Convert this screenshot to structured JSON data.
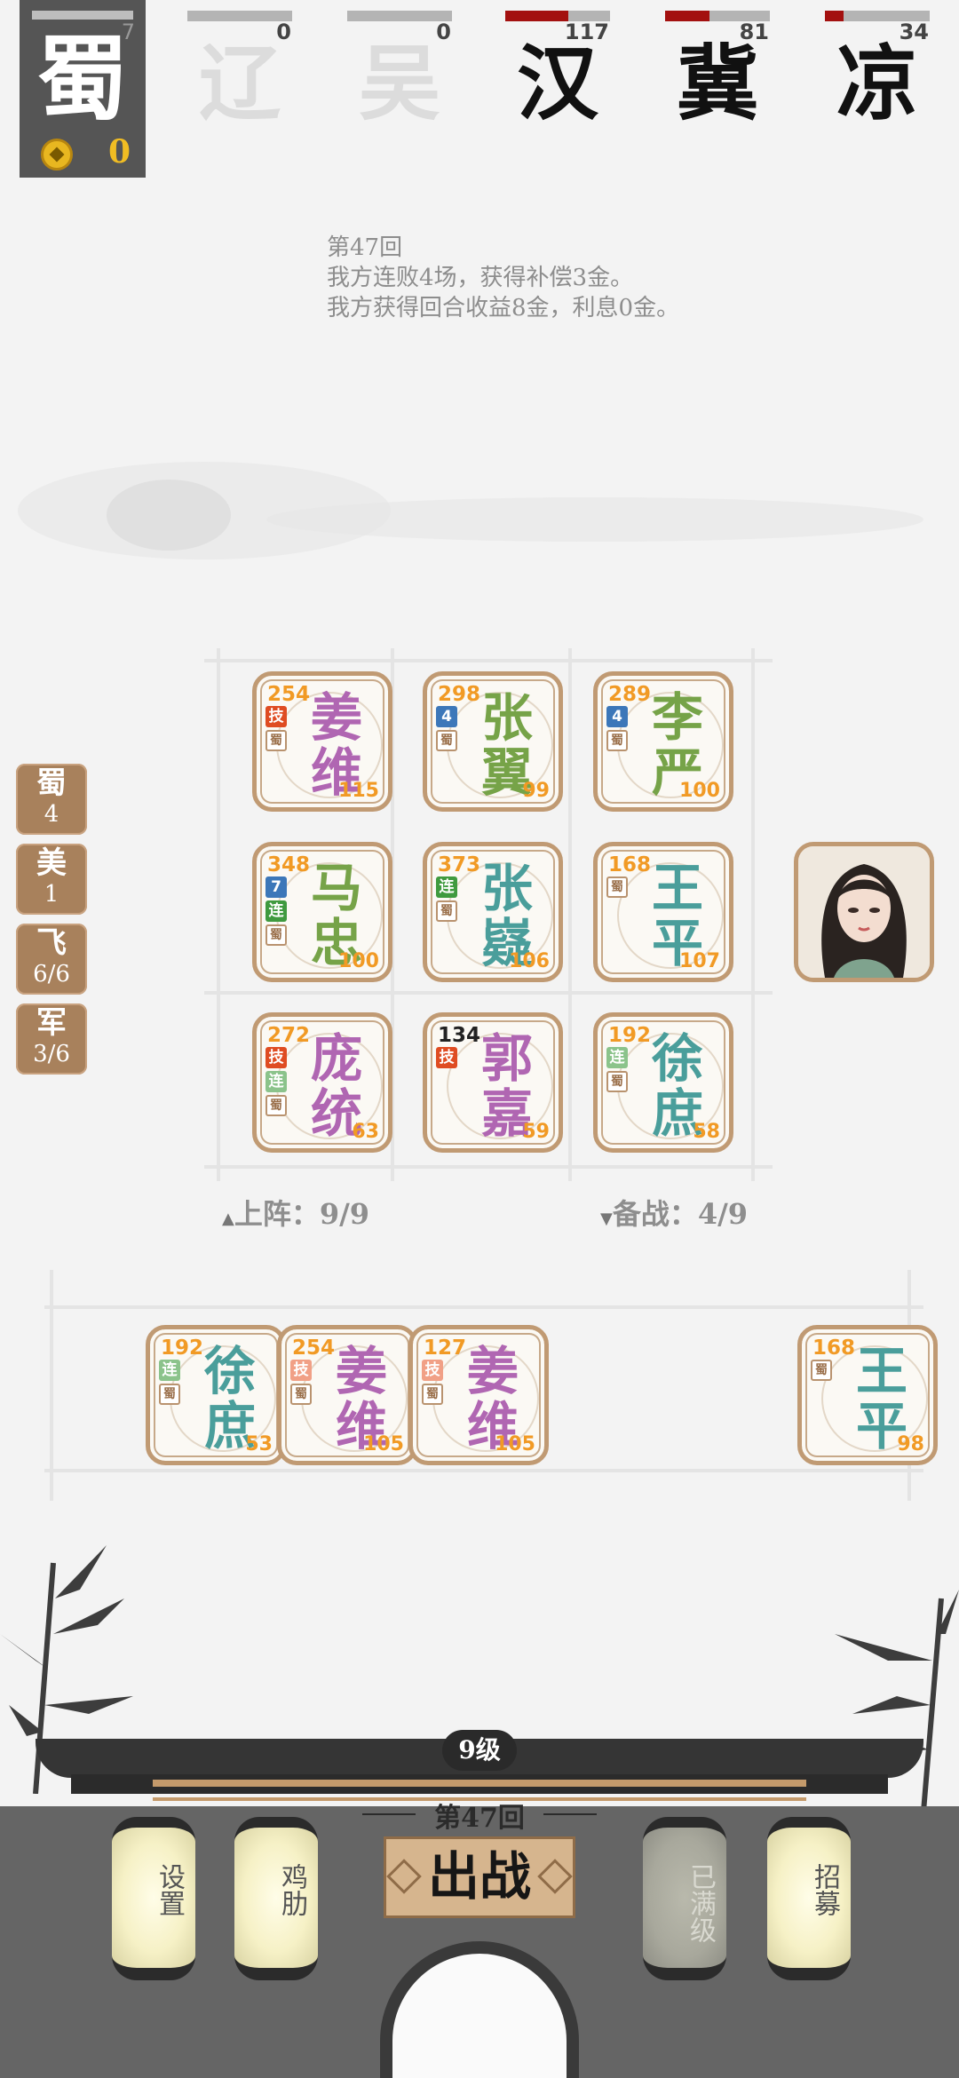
{
  "player": {
    "faction": "蜀",
    "hp": "7",
    "gold": "0"
  },
  "factions": [
    {
      "name": "辽",
      "hp": "0",
      "hp_fraction": 0,
      "active": false
    },
    {
      "name": "吴",
      "hp": "0",
      "hp_fraction": 0,
      "active": false
    },
    {
      "name": "汉",
      "hp": "117",
      "hp_fraction": 0.6,
      "active": true
    },
    {
      "name": "冀",
      "hp": "81",
      "hp_fraction": 0.42,
      "active": true
    },
    {
      "name": "凉",
      "hp": "34",
      "hp_fraction": 0.18,
      "active": true
    }
  ],
  "log": {
    "line1": "第47回",
    "line2": "我方连败4场，获得补偿3金。",
    "line3": "我方获得回合收益8金，利息0金。"
  },
  "board": [
    {
      "name_top": "姜",
      "name_bottom": "维",
      "hp": "254",
      "atk": "115",
      "color": "purple",
      "tags": [
        "技",
        "蜀"
      ]
    },
    {
      "name_top": "张",
      "name_bottom": "翼",
      "hp": "298",
      "atk": "99",
      "color": "green",
      "tags": [
        "4",
        "蜀"
      ]
    },
    {
      "name_top": "李",
      "name_bottom": "严",
      "hp": "289",
      "atk": "100",
      "color": "green",
      "tags": [
        "4",
        "蜀"
      ]
    },
    {
      "name_top": "马",
      "name_bottom": "忠",
      "hp": "348",
      "atk": "100",
      "color": "green",
      "tags": [
        "7",
        "连",
        "蜀"
      ]
    },
    {
      "name_top": "张",
      "name_bottom": "嶷",
      "hp": "373",
      "atk": "106",
      "color": "teal",
      "tags": [
        "连",
        "蜀"
      ]
    },
    {
      "name_top": "王",
      "name_bottom": "平",
      "hp": "168",
      "atk": "107",
      "color": "teal",
      "tags": [
        "蜀"
      ]
    },
    {
      "name_top": "庞",
      "name_bottom": "统",
      "hp": "272",
      "atk": "63",
      "color": "purple",
      "tags": [
        "技",
        "连",
        "蜀"
      ]
    },
    {
      "name_top": "郭",
      "name_bottom": "嘉",
      "hp": "134",
      "atk": "59",
      "color": "purple",
      "tags": [
        "技"
      ]
    },
    {
      "name_top": "徐",
      "name_bottom": "庶",
      "hp": "192",
      "atk": "58",
      "color": "teal",
      "tags": [
        "连",
        "蜀"
      ]
    }
  ],
  "bench": [
    {
      "name_top": "徐",
      "name_bottom": "庶",
      "hp": "192",
      "atk": "53",
      "color": "teal",
      "tags": [
        "连",
        "蜀"
      ]
    },
    {
      "name_top": "姜",
      "name_bottom": "维",
      "hp": "254",
      "atk": "105",
      "color": "purple",
      "tags": [
        "技",
        "蜀"
      ]
    },
    {
      "name_top": "姜",
      "name_bottom": "维",
      "hp": "127",
      "atk": "105",
      "color": "purple",
      "tags": [
        "技",
        "蜀"
      ]
    },
    {
      "name_top": "王",
      "name_bottom": "平",
      "hp": "168",
      "atk": "98",
      "color": "teal",
      "tags": [
        "蜀"
      ]
    }
  ],
  "traits": [
    {
      "name": "蜀",
      "count": "4"
    },
    {
      "name": "美",
      "count": "1"
    },
    {
      "name": "飞",
      "count": "6/6"
    },
    {
      "name": "军",
      "count": "3/6"
    }
  ],
  "counters": {
    "deployed_label": "上阵：9/9",
    "bench_label": "备战：4/9"
  },
  "bottom": {
    "level": "9级",
    "round": "第47回",
    "fight_button": "出战",
    "settings_label": "设置",
    "chicken_label": "鸡肋",
    "maxlevel_label": "已满级",
    "recruit_label": "招募"
  },
  "colors": {
    "purple": "#b066b2",
    "green": "#76a348",
    "teal": "#4a9e9b",
    "hp_orange": "#f19a25",
    "card_border": "#c09a73",
    "hp_red": "#a3100f"
  }
}
